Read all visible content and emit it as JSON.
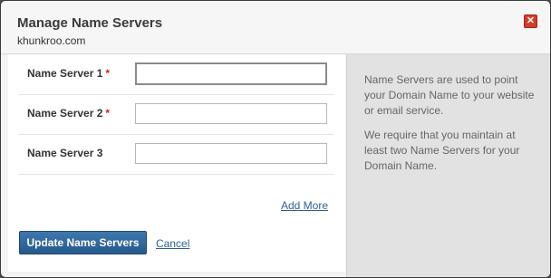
{
  "dialog": {
    "title": "Manage Name Servers",
    "domain": "khunkroo.com",
    "close_icon": "✕"
  },
  "form": {
    "fields": [
      {
        "label": "Name Server 1",
        "required": "*",
        "value": ""
      },
      {
        "label": "Name Server 2",
        "required": "*",
        "value": ""
      },
      {
        "label": "Name Server 3",
        "required": "",
        "value": ""
      }
    ],
    "add_more": "Add More",
    "submit": "Update Name Servers",
    "cancel": "Cancel"
  },
  "help": {
    "p1": "Name Servers are used to point your Domain Name to your website or email service.",
    "p2": "We require that you maintain at least two Name Servers for your Domain Name."
  },
  "colors": {
    "accent": "#27598b",
    "required": "#cc2222",
    "close": "#d23b2a"
  }
}
